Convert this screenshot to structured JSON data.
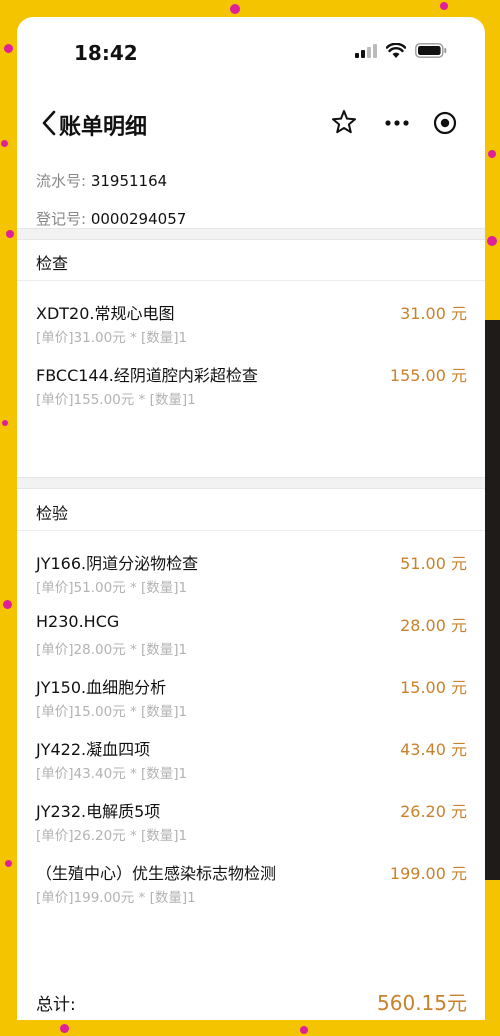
{
  "status_bar": {
    "time": "18:42"
  },
  "nav": {
    "title": "账单明细",
    "icons": [
      "back-chevron-icon",
      "star-icon",
      "more-icon",
      "target-icon"
    ]
  },
  "info": {
    "serial_label": "流水号:",
    "serial_value": "31951164",
    "reg_label": "登记号:",
    "reg_value": "0000294057"
  },
  "sections": [
    {
      "title": "检查",
      "items": [
        {
          "name": "XDT20.常规心电图",
          "price": "31.00 元",
          "detail": "[单价]31.00元 * [数量]1"
        },
        {
          "name": "FBCC144.经阴道腔内彩超检查",
          "price": "155.00 元",
          "detail": "[单价]155.00元 * [数量]1"
        }
      ]
    },
    {
      "title": "检验",
      "items": [
        {
          "name": "JY166.阴道分泌物检查",
          "price": "51.00 元",
          "detail": "[单价]51.00元 * [数量]1"
        },
        {
          "name": "H230.HCG",
          "price": "28.00 元",
          "detail": "[单价]28.00元 * [数量]1"
        },
        {
          "name": "JY150.血细胞分析",
          "price": "15.00 元",
          "detail": "[单价]15.00元 * [数量]1"
        },
        {
          "name": "JY422.凝血四项",
          "price": "43.40 元",
          "detail": "[单价]43.40元 * [数量]1"
        },
        {
          "name": "JY232.电解质5项",
          "price": "26.20 元",
          "detail": "[单价]26.20元 * [数量]1"
        },
        {
          "name": "（生殖中心）优生感染标志物检测",
          "price": "199.00 元",
          "detail": "[单价]199.00元 * [数量]1"
        }
      ]
    }
  ],
  "total": {
    "label": "总计:",
    "value": "560.15元"
  },
  "colors": {
    "price": "#c9822b",
    "detail": "#b3b3b3",
    "backdrop": "#f5c400"
  }
}
